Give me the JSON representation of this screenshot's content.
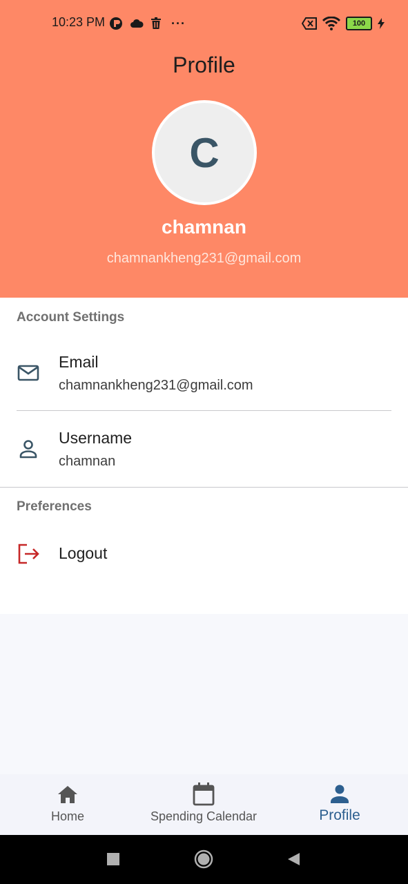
{
  "status_bar": {
    "time": "10:23 PM",
    "more": "···",
    "battery": "100"
  },
  "header": {
    "title": "Profile",
    "avatar_letter": "C",
    "name": "chamnan",
    "email": "chamnankheng231@gmail.com",
    "background_color": "#fe8866"
  },
  "account_settings": {
    "heading": "Account Settings",
    "email": {
      "label": "Email",
      "value": "chamnankheng231@gmail.com",
      "icon": "mail-icon"
    },
    "username": {
      "label": "Username",
      "value": "chamnan",
      "icon": "person-outline-icon"
    }
  },
  "preferences": {
    "heading": "Preferences",
    "logout": {
      "label": "Logout",
      "icon": "logout-icon",
      "color": "#c62828"
    }
  },
  "bottom_nav": {
    "items": [
      {
        "label": "Home",
        "icon": "home-icon",
        "active": false
      },
      {
        "label": "Spending Calendar",
        "icon": "calendar-icon",
        "active": false
      },
      {
        "label": "Profile",
        "icon": "person-icon",
        "active": true
      }
    ],
    "active_color": "#2d5f8f"
  }
}
